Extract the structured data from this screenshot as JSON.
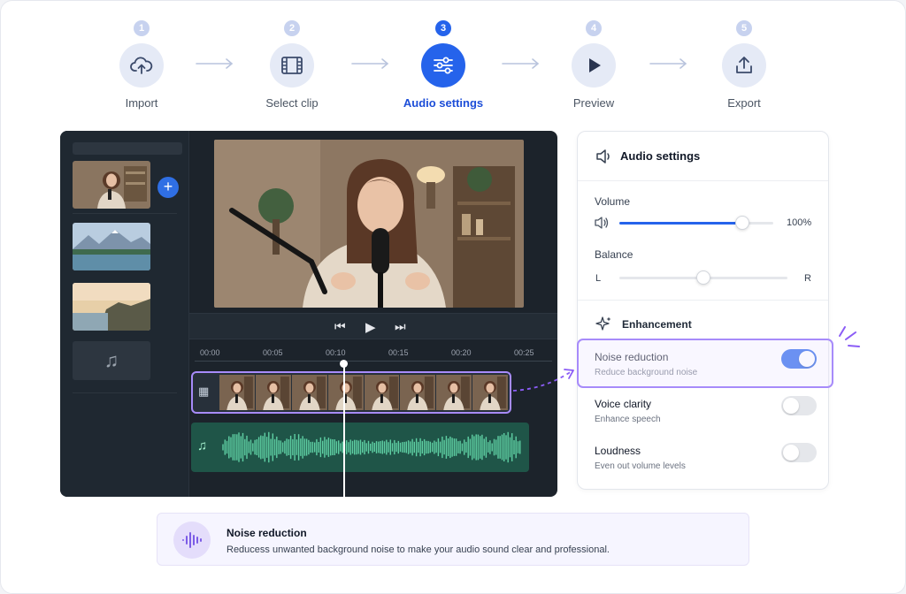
{
  "steps": [
    {
      "num": "1",
      "label": "Import",
      "icon": "cloud-upload-icon"
    },
    {
      "num": "2",
      "label": "Select clip",
      "icon": "film-icon"
    },
    {
      "num": "3",
      "label": "Audio settings",
      "icon": "sliders-icon",
      "active": true
    },
    {
      "num": "4",
      "label": "Preview",
      "icon": "play-icon"
    },
    {
      "num": "5",
      "label": "Export",
      "icon": "share-icon"
    }
  ],
  "timeline": {
    "ticks": [
      "00:00",
      "00:05",
      "00:10",
      "00:15",
      "00:20",
      "00:25"
    ]
  },
  "settings": {
    "title": "Audio settings",
    "volume_label": "Volume",
    "volume_value": "100%",
    "volume_level": 0.8,
    "balance_label": "Balance",
    "balance_left": "L",
    "balance_right": "R",
    "balance_level": 0.5,
    "enhancement_title": "Enhancement",
    "options": [
      {
        "title": "Noise reduction",
        "subtitle": "Reduce background noise",
        "enabled": true
      },
      {
        "title": "Voice clarity",
        "subtitle": "Enhance speech",
        "enabled": false
      },
      {
        "title": "Loudness",
        "subtitle": "Even out volume levels",
        "enabled": false
      }
    ]
  },
  "info": {
    "title": "Noise reduction",
    "text": "Reducess unwanted background noise to make your audio sound clear and professional."
  },
  "colors": {
    "accent": "#2563eb",
    "highlight": "#a78bfa",
    "waveform": "#5fd0a4"
  }
}
